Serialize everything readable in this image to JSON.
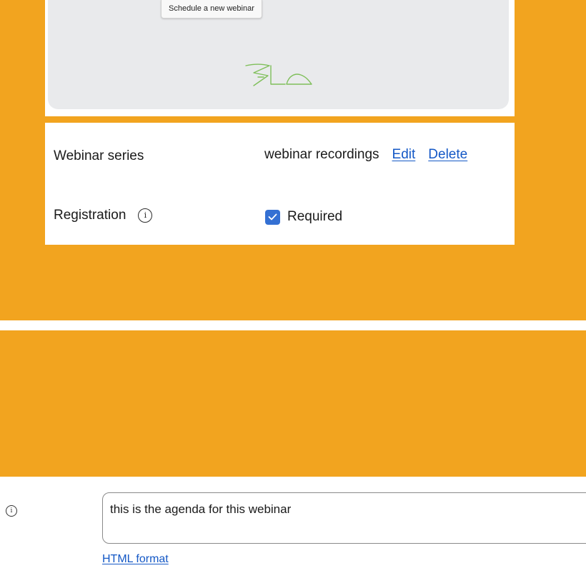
{
  "preview": {
    "tooltip_text": "Schedule a new webinar"
  },
  "settings": {
    "webinar_series": {
      "label": "Webinar series",
      "value": "webinar recordings",
      "edit_label": "Edit",
      "delete_label": "Delete"
    },
    "registration": {
      "label": "Registration",
      "info_icon": "info-icon",
      "checkbox_label": "Required",
      "checked": true
    }
  },
  "agenda": {
    "info_icon": "info-icon",
    "value": "this is the agenda for this webinar",
    "format_link": "HTML format"
  },
  "colors": {
    "background_accent": "#f2a41f",
    "link": "#1458c6",
    "checkbox": "#3470d3",
    "signature": "#7fbf5a"
  }
}
